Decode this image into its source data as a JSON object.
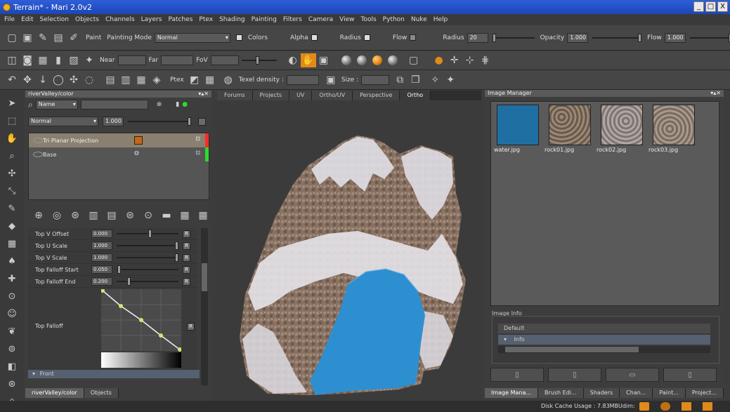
{
  "window": {
    "title": "Terrain* - Mari 2.0v2",
    "min": "_",
    "max": "□",
    "close": "X"
  },
  "menu": [
    "File",
    "Edit",
    "Selection",
    "Objects",
    "Channels",
    "Layers",
    "Patches",
    "Ptex",
    "Shading",
    "Painting",
    "Filters",
    "Camera",
    "View",
    "Tools",
    "Python",
    "Nuke",
    "Help"
  ],
  "toolbar1": {
    "paint_label": "Paint",
    "painting_mode_label": "Painting Mode",
    "painting_mode_value": "Normal",
    "colors_label": "Colors",
    "alpha_label": "Alpha",
    "radius_check_label": "Radius",
    "flow_check_label": "Flow",
    "radius_label": "Radius",
    "radius_value": "20",
    "opacity_label": "Opacity",
    "opacity_value": "1.000",
    "flow_label": "Flow",
    "flow_value": "1.000"
  },
  "toolbar2": {
    "near_label": "Near",
    "far_label": "Far",
    "fov_label": "FoV"
  },
  "toolbar3": {
    "ptex_label": "Ptex",
    "texel_density_label": "Texel density :",
    "size_label": "Size :"
  },
  "layers_panel": {
    "title": "riverValley/color",
    "filter_value": "Name",
    "blend_mode": "Normal",
    "opacity": "1.000",
    "layers": [
      {
        "name": "Tri Planar Projection",
        "status_color": "#ff2a2a"
      },
      {
        "name": "Base",
        "status_color": "#2adc2a"
      }
    ]
  },
  "properties": [
    {
      "label": "Top V Offset",
      "value": "0.000",
      "level": 0.55
    },
    {
      "label": "Top U Scale",
      "value": "1.000",
      "level": 0.98
    },
    {
      "label": "Top V Scale",
      "value": "1.000",
      "level": 0.98
    },
    {
      "label": "Top Falloff Start",
      "value": "0.050",
      "level": 0.05
    },
    {
      "label": "Top Falloff End",
      "value": "0.200",
      "level": 0.2
    }
  ],
  "falloff": {
    "label": "Top Falloff",
    "reset": "R"
  },
  "front_section": "Front",
  "reset_label": "R",
  "left_tabs": [
    "riverValley/color",
    "Objects"
  ],
  "viewport_tabs": [
    "Forums",
    "Projects",
    "UV",
    "Ortho/UV",
    "Perspective",
    "Ortho"
  ],
  "viewport_active": "Ortho",
  "image_manager": {
    "title": "Image Manager",
    "images": [
      {
        "name": "water.jpg",
        "color": "#1f6fa3"
      },
      {
        "name": "rock01.jpg",
        "color": "#7d6a5a"
      },
      {
        "name": "rock02.jpg",
        "color": "#9a8f8a"
      },
      {
        "name": "rock03.jpg",
        "color": "#8f8075"
      }
    ],
    "image_info_label": "Image Info",
    "default_label": "Default",
    "info_label": "Info"
  },
  "bottom_tabs": [
    "Image Mana...",
    "Brush Edi...",
    "Shaders",
    "Chan...",
    "Paint...",
    "Project..."
  ],
  "status": {
    "disk_cache": "Disk Cache Usage : 7.83MB",
    "udim": "Udim:"
  },
  "colors": {
    "accent_orange": "#e08a1a",
    "water_blue": "#2e8fd0",
    "title_blue": "#2456c8"
  }
}
